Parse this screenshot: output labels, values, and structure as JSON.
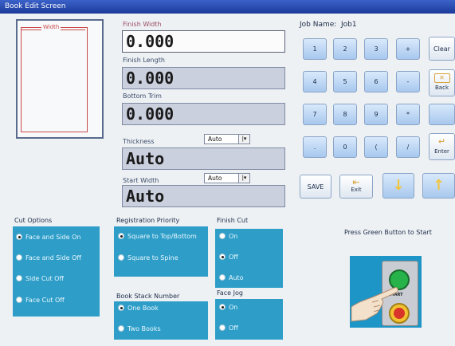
{
  "window": {
    "title": "Book Edit Screen"
  },
  "diagram": {
    "width_label": "Width"
  },
  "fields": {
    "finish_width": {
      "label": "Finish Width",
      "value": "0.000"
    },
    "finish_length": {
      "label": "Finish Length",
      "value": "0.000"
    },
    "bottom_trim": {
      "label": "Bottom Trim",
      "value": "0.000"
    },
    "thickness": {
      "label": "Thickness",
      "value": "Auto",
      "dropdown": "Auto"
    },
    "start_width": {
      "label": "Start Width",
      "value": "Auto",
      "dropdown": "Auto"
    }
  },
  "job": {
    "label": "Job Name:",
    "value": "Job1"
  },
  "keypad": {
    "keys": [
      "1",
      "2",
      "3",
      "+",
      "4",
      "5",
      "6",
      "-",
      "7",
      "8",
      "9",
      "*",
      ".",
      "0",
      "(",
      "/"
    ],
    "clear": "Clear",
    "back": "Back",
    "enter": "Enter"
  },
  "actions": {
    "save": "SAVE",
    "exit": "Exit"
  },
  "cut_options": {
    "title": "Cut Options",
    "options": [
      "Face and Side On",
      "Face and Side Off",
      "Side Cut Off",
      "Face Cut Off"
    ],
    "selected": 0
  },
  "registration_priority": {
    "title": "Registration Priority",
    "options": [
      "Square to Top/Bottom",
      "Square to Spine"
    ],
    "selected": 0
  },
  "finish_cut": {
    "title": "Finish Cut",
    "options": [
      "On",
      "Off",
      "Auto"
    ],
    "selected": 1
  },
  "book_stack": {
    "title": "Book Stack Number",
    "options": [
      "One Book",
      "Two Books"
    ],
    "selected": 0
  },
  "face_jog": {
    "title": "Face Jog",
    "options": [
      "On",
      "Off"
    ],
    "selected": 0
  },
  "instruction": {
    "text": "Press Green Button to Start",
    "start_label": "START"
  },
  "colors": {
    "panel": "#2e9ec9",
    "title_bar": "#1c3a9a",
    "key": "#a8c8ee"
  }
}
